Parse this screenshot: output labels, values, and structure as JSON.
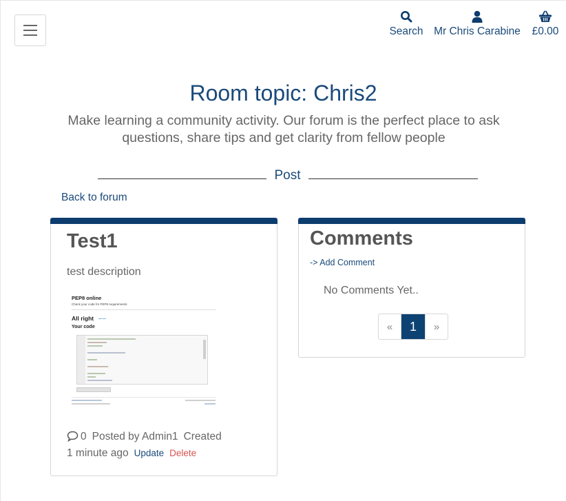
{
  "header": {
    "search_label": "Search",
    "user_label": "Mr Chris Carabine",
    "basket_label": "£0.00",
    "icon_color": "#1a4a7a"
  },
  "hero": {
    "title": "Room topic: Chris2",
    "subtitle": "Make learning a community activity. Our forum is the perfect place to ask questions, share tips and get clarity from fellow people",
    "divider_label": "Post",
    "back_link": "Back to forum"
  },
  "post": {
    "title": "Test1",
    "description": "test description",
    "image": {
      "heading": "PEP8 online",
      "subheading": "Check your code for PEP8 requirements",
      "result": "All right",
      "code_label": "Your code"
    },
    "comment_count": "0",
    "posted_by": "Posted by Admin1",
    "created": "Created",
    "time_ago": "1 minute ago",
    "update_label": "Update",
    "delete_label": "Delete"
  },
  "comments": {
    "title": "Comments",
    "add_label": "-> Add Comment",
    "empty_text": "No Comments Yet..",
    "pagination": {
      "prev": "«",
      "current": "1",
      "next": "»"
    }
  },
  "colors": {
    "accent": "#0d3c6e",
    "link": "#1a4a7a",
    "danger": "#d9534f"
  }
}
